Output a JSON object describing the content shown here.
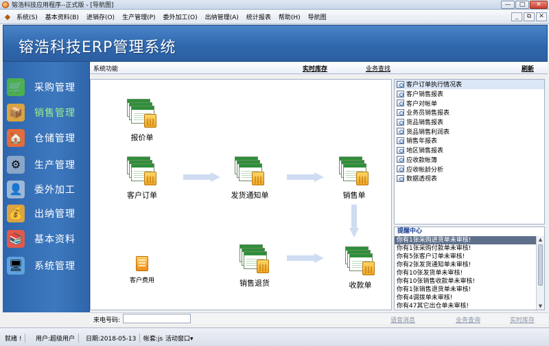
{
  "window": {
    "title": "镕浩科技应用程序--正式版 - [导航图]",
    "min": "—",
    "max": "□",
    "close": "✕"
  },
  "menu": {
    "items": [
      "系统(S)",
      "基本资料(B)",
      "进销存(O)",
      "生产管理(P)",
      "委外加工(O)",
      "出纳管理(A)",
      "统计报表",
      "帮助(H)",
      "导航图"
    ],
    "mdi": [
      "_",
      "⧉",
      "✕"
    ]
  },
  "banner": {
    "title": "镕浩科技ERP管理系统"
  },
  "nav": {
    "items": [
      {
        "label": "采购管理",
        "icon": "purchase-icon",
        "active": false
      },
      {
        "label": "销售管理",
        "icon": "sales-icon",
        "active": true
      },
      {
        "label": "仓储管理",
        "icon": "warehouse-icon",
        "active": false
      },
      {
        "label": "生产管理",
        "icon": "production-icon",
        "active": false
      },
      {
        "label": "委外加工",
        "icon": "outsource-icon",
        "active": false
      },
      {
        "label": "出纳管理",
        "icon": "cashier-icon",
        "active": false
      },
      {
        "label": "基本资料",
        "icon": "basic-data-icon",
        "active": false
      },
      {
        "label": "系统管理",
        "icon": "system-icon",
        "active": false
      }
    ]
  },
  "workspace": {
    "system_functions": "系统功能",
    "realtime_stock": "实时库存",
    "business_query": "业务查找",
    "refresh": "刷新"
  },
  "flow": {
    "quote": "报价单",
    "customer_order": "客户订单",
    "delivery_notice": "发货通知单",
    "sales_order": "销售单",
    "customer_fee": "客户费用",
    "sales_return": "销售退货",
    "receipt": "收款单"
  },
  "reports": [
    "客户订单执行情况表",
    "客户销售报表",
    "客户对帐单",
    "业务员销售报表",
    "货品销售报表",
    "货品销售利润表",
    "销售年报表",
    "地区销售报表",
    "应收款帐簿",
    "应收帐龄分析",
    "数据透视表"
  ],
  "reminder": {
    "title": "提醒中心",
    "items": [
      "你有1张采购进货单未审核!",
      "你有1张采购付款单未审核!",
      "你有5张客户订单未审核!",
      "你有2张发货通知单未审核!",
      "你有10张发货单未审核!",
      "你有10张销售收款单未审核!",
      "你有1张销售退货单未审核!",
      "你有4调拨单未审核!",
      "你有47其它出仓单未审核!"
    ]
  },
  "caller": {
    "label": "来电号码:",
    "value": "",
    "link_messages": "语音消息",
    "link_business": "业务查询",
    "link_realtime": "实时库存"
  },
  "status": {
    "ready": "就绪 !",
    "user": "用户:超级用户",
    "date": "日期:2018-05-13",
    "account": "帐套:js",
    "active_window": "活动窗口▾"
  }
}
